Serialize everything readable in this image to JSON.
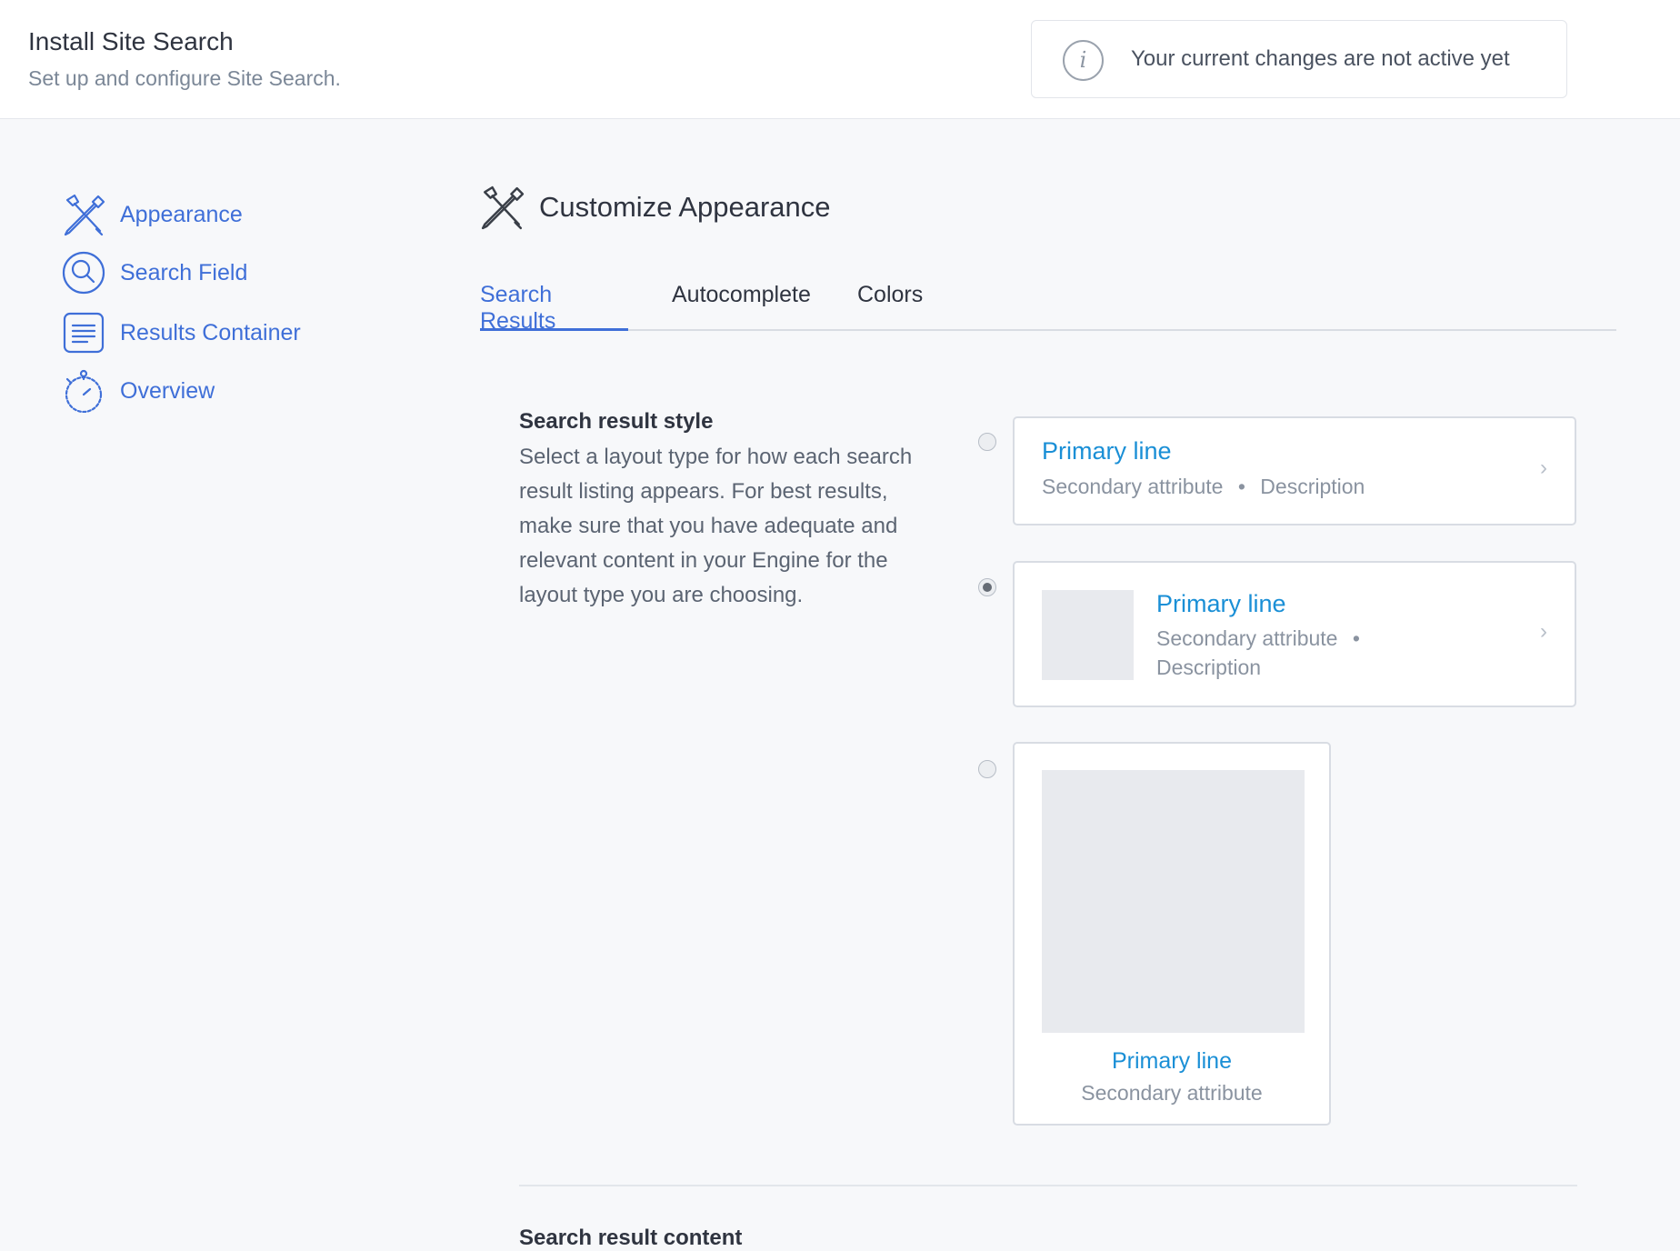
{
  "header": {
    "title": "Install Site Search",
    "subtitle": "Set up and configure Site Search.",
    "notice": "Your current changes are not active yet",
    "notice_icon": "info-icon"
  },
  "sidebar": {
    "items": [
      {
        "label": "Appearance",
        "icon": "wrench-screwdriver-icon"
      },
      {
        "label": "Search Field",
        "icon": "magnifier-icon"
      },
      {
        "label": "Results Container",
        "icon": "document-lines-icon"
      },
      {
        "label": "Overview",
        "icon": "stopwatch-icon"
      }
    ]
  },
  "main": {
    "title": "Customize Appearance",
    "icon": "wrench-screwdriver-icon",
    "tabs": [
      {
        "label": "Search Results",
        "active": true
      },
      {
        "label": "Autocomplete",
        "active": false
      },
      {
        "label": "Colors",
        "active": false
      }
    ],
    "section": {
      "heading": "Search result style",
      "description": "Select a layout type for how each search result listing appears. For best results, make sure that you have adequate and relevant content in your Engine for the layout type you are choosing."
    },
    "options": [
      {
        "primary": "Primary line",
        "secondary": "Secondary attribute",
        "description": "Description",
        "selected": false
      },
      {
        "primary": "Primary line",
        "secondary": "Secondary attribute",
        "description": "Description",
        "selected": true
      },
      {
        "primary": "Primary line",
        "secondary": "Secondary attribute",
        "selected": false
      }
    ],
    "next_section_heading": "Search result content"
  },
  "colors": {
    "accent": "#3f6fd8",
    "primary_link": "#1a8fd6",
    "background": "#f7f8fa"
  }
}
